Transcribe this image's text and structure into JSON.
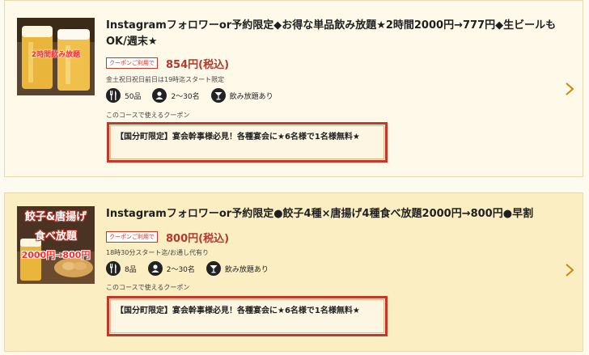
{
  "courses": [
    {
      "thumb_caption": "2時間飲み放題",
      "title": "Instagramフォロワーor予約限定◆お得な単品飲み放題★2時間2000円→777円◆生ビールもOK/週末★",
      "coupon_tag": "クーポンご利用で",
      "price": "854円(税込)",
      "note": "金土祝日祝日前日は19時迄スタート限定",
      "dishes": "50品",
      "people": "2～30名",
      "drink": "飲み放題あり",
      "coupon_caption": "このコースで使えるクーポン",
      "coupon_text": "【国分町限定】宴会幹事様必見！各種宴会に★6名様で1名様無料★"
    },
    {
      "thumb_title1": "餃子&唐揚げ",
      "thumb_title2": "食べ放題",
      "thumb_price": "2000円→800円",
      "title": "Instagramフォロワーor予約限定●餃子4種×唐揚げ4種食べ放題2000円→800円●早割",
      "coupon_tag": "クーポンご利用で",
      "price": "800円(税込)",
      "note": "18時30分スタート迄/お通し代有り",
      "dishes": "8品",
      "people": "2～30名",
      "drink": "飲み放題あり",
      "coupon_caption": "このコースで使えるクーポン",
      "coupon_text": "【国分町限定】宴会幹事様必見！各種宴会に★6名様で1名様無料★"
    }
  ],
  "colors": {
    "accent": "#c0392b",
    "price": "#b03a2e",
    "chevron": "#c8890d"
  },
  "icons": {
    "dishes": "fork-knife-icon",
    "people": "person-icon",
    "drink": "cocktail-icon",
    "chevron": "chevron-right-icon"
  }
}
